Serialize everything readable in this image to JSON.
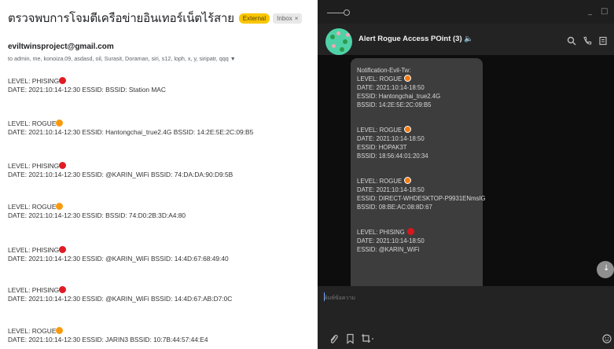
{
  "email": {
    "subject": "ตรวจพบการโจมตีเครือข่ายอินเทอร์เน็ตไร้สาย",
    "badge_external": "External",
    "badge_inbox": "Inbox",
    "sender": "eviltwinsproject@gmail.com",
    "recipients": "to admin, me, konoiza.09, asdasd, oil, Surasit, Doraman, siri, s12, loph, x, y, siripatr, qqq",
    "entries": [
      {
        "level": "LEVEL: PHISING",
        "dot": "red",
        "detail": "DATE: 2021:10:14-12:30 ESSID:  BSSID: Station MAC"
      },
      {
        "level": "LEVEL: ROGUE",
        "dot": "orange",
        "detail": "DATE: 2021:10:14-12:30 ESSID:  Hantongchai_true2.4G BSSID: 14:2E:5E:2C:09:B5"
      },
      {
        "level": "LEVEL: PHISING",
        "dot": "red",
        "detail": "DATE: 2021:10:14-12:30 ESSID:  @KARIN_WiFi BSSID: 74:DA:DA:90:D9:5B"
      },
      {
        "level": "LEVEL: ROGUE",
        "dot": "orange",
        "detail": "DATE: 2021:10:14-12:30 ESSID:   BSSID: 74:D0:2B:3D:A4:80"
      },
      {
        "level": "LEVEL: PHISING",
        "dot": "red",
        "detail": "DATE: 2021:10:14-12:30 ESSID:  @KARIN_WiFi BSSID: 14:4D:67:68:49:40"
      },
      {
        "level": "LEVEL: PHISING",
        "dot": "red",
        "detail": "DATE: 2021:10:14-12:30 ESSID:  @KARIN_WiFi BSSID: 14:4D:67:AB:D7:0C"
      },
      {
        "level": "LEVEL: ROGUE",
        "dot": "orange",
        "detail": "DATE: 2021:10:14-12:30 ESSID:  JARIN3 BSSID: 10:7B:44:57:44:E4"
      }
    ]
  },
  "telegram": {
    "chat_title": "Alert Rogue Access POint (3) 🔈",
    "window_controls": {
      "minimize": "_",
      "maximize": "□"
    },
    "message": {
      "header": "Notification-Evil-Tw:",
      "blocks": [
        {
          "level": "LEVEL: ROGUE",
          "dot": "orange",
          "date": "DATE: 2021:10:14-18:50",
          "essid": "ESSID:  Hantongchai_true2.4G",
          "bssid": "BSSID: 14:2E:5E:2C:09:B5"
        },
        {
          "level": "LEVEL: ROGUE",
          "dot": "orange",
          "date": "DATE: 2021:10:14-18:50",
          "essid": "ESSID:  HOPAK3T",
          "bssid": "BSSID: 18:56:44:01:20:34"
        },
        {
          "level": "LEVEL: ROGUE",
          "dot": "orange",
          "date": "DATE: 2021:10:14-18:50",
          "essid": "ESSID:  DIRECT-WHDESKTOP-P9931ENmsIG",
          "bssid": "BSSID: 08:BE:AC:08:8D:67"
        },
        {
          "level": "LEVEL: PHISING",
          "dot": "red",
          "date": "DATE: 2021:10:14-18:50",
          "essid": "ESSID:  @KARIN_WiFi",
          "bssid": ""
        }
      ]
    },
    "input_placeholder": "พิมพ์ข้อความ",
    "icons": [
      "search-icon",
      "phone-icon",
      "menu-icon",
      "attach-icon",
      "bookmark-icon",
      "crop-icon",
      "emoji-icon",
      "scroll-down-icon"
    ]
  },
  "colors": {
    "phishing_dot": "#e01b24",
    "rogue_dot": "#f99a0e",
    "external_badge": "#f9c600",
    "telegram_dark": "#232323"
  }
}
